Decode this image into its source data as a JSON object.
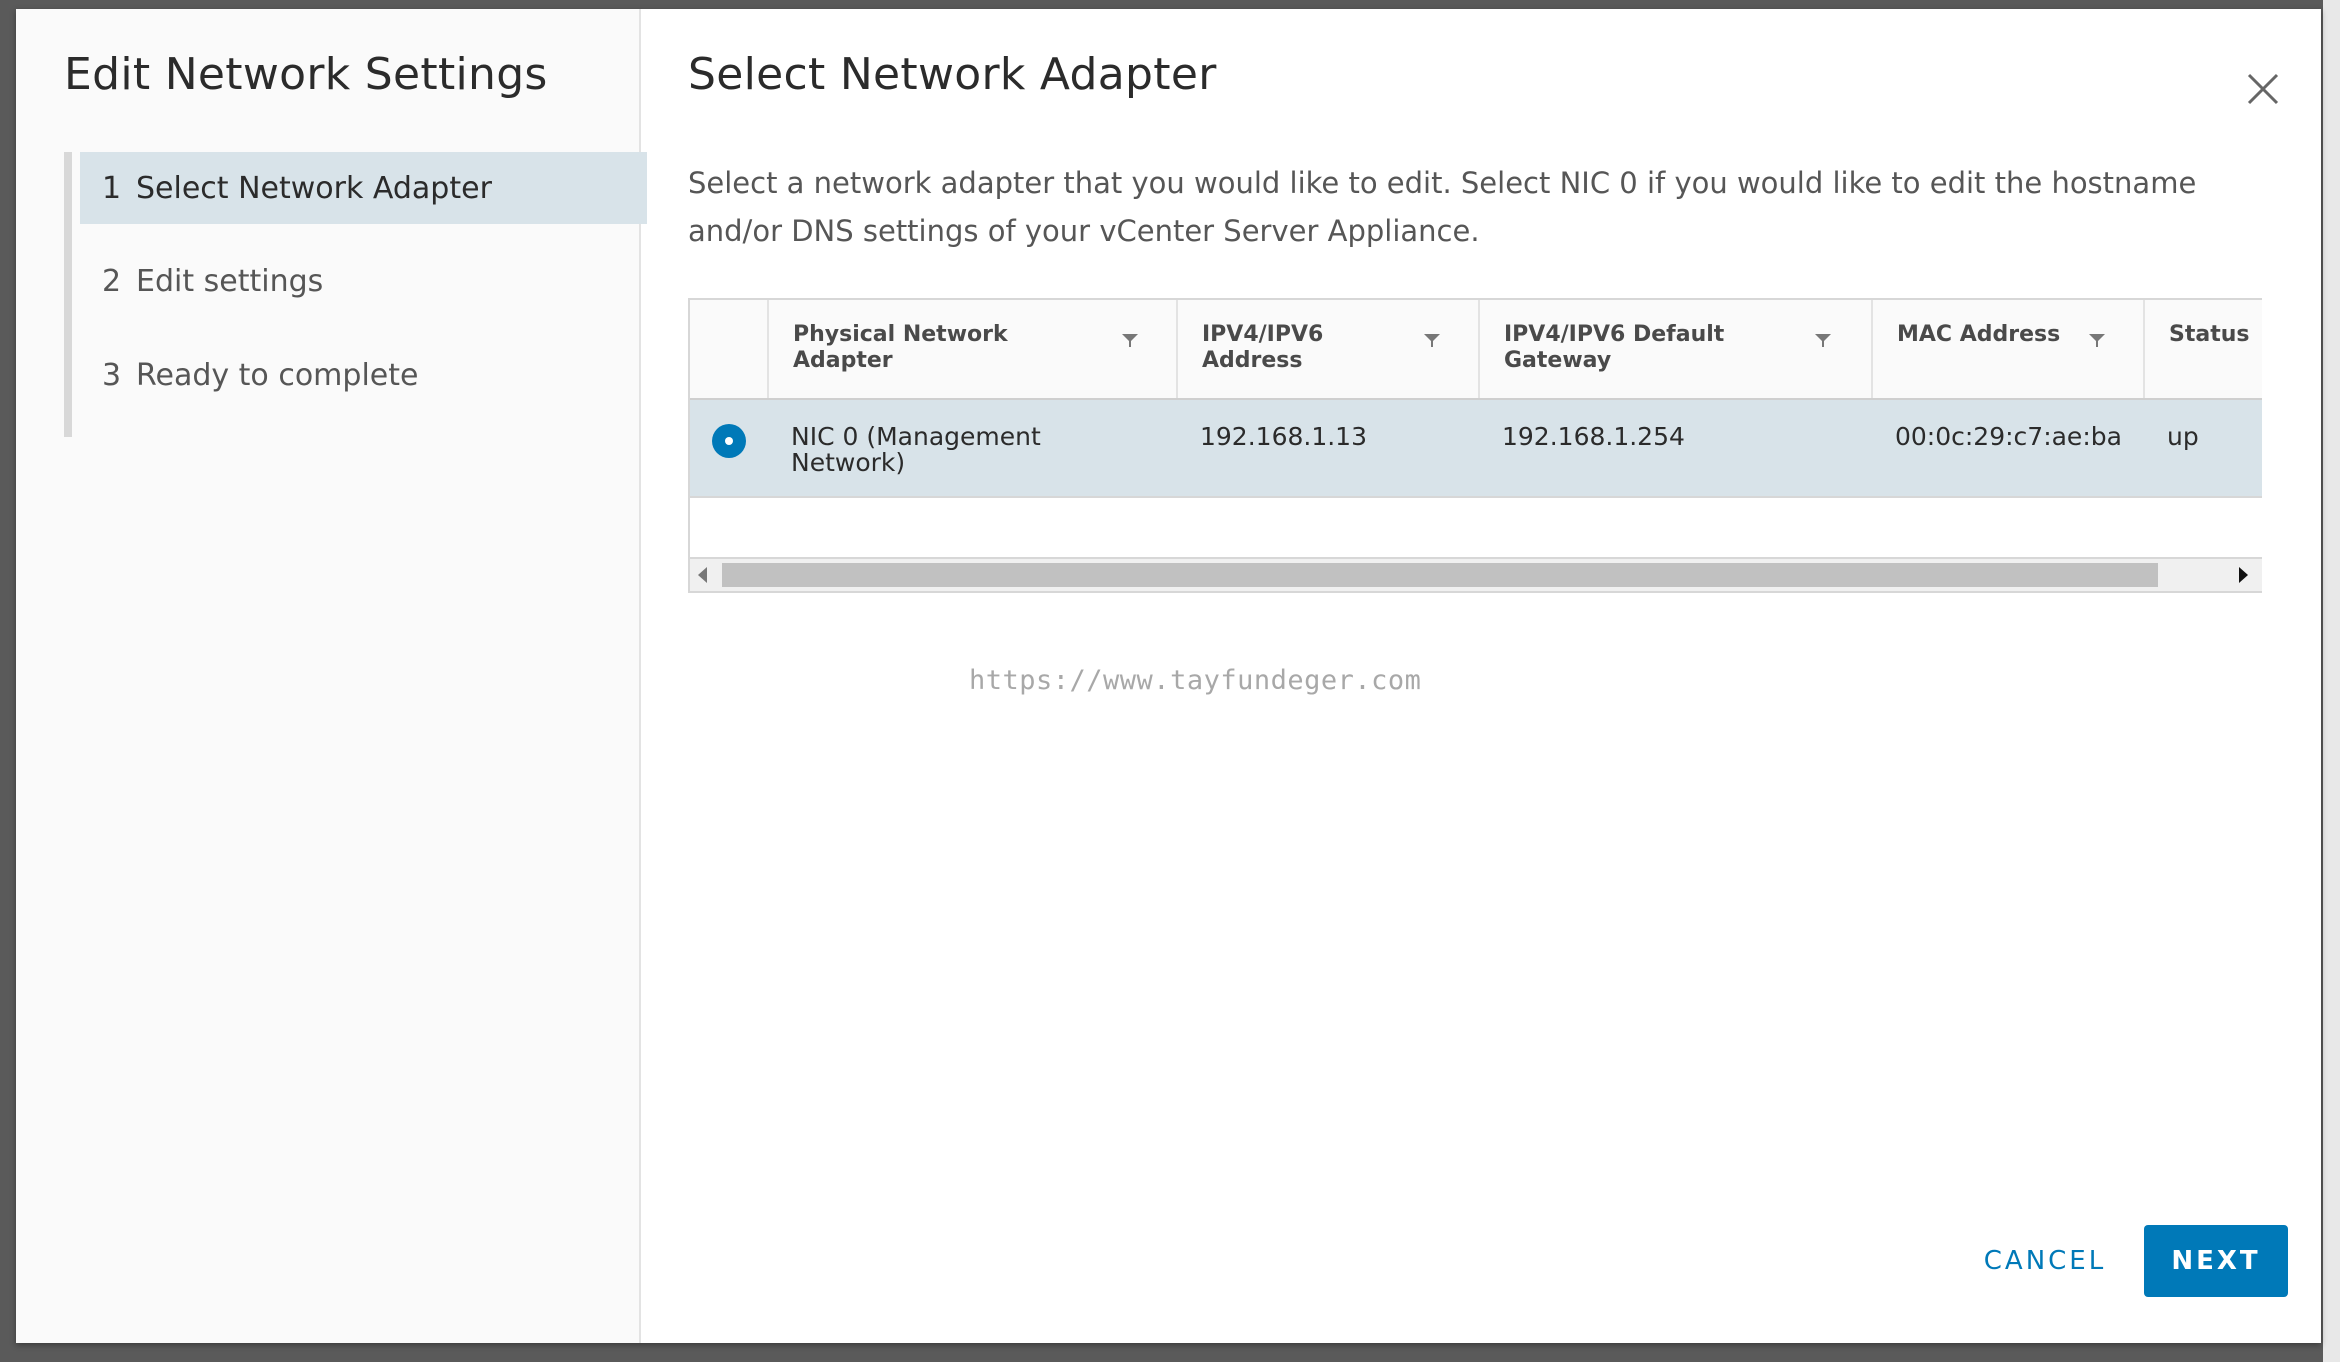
{
  "wizard": {
    "title": "Edit Network Settings",
    "steps": [
      {
        "number": "1",
        "label": "Select Network Adapter",
        "active": true
      },
      {
        "number": "2",
        "label": "Edit settings",
        "active": false
      },
      {
        "number": "3",
        "label": "Ready to complete",
        "active": false
      }
    ]
  },
  "page": {
    "title": "Select Network Adapter",
    "description": "Select a network adapter that you would like to edit. Select NIC 0 if you would like to edit the hostname and/or DNS settings of your vCenter Server Appliance.",
    "close_icon": "close-icon"
  },
  "grid": {
    "columns": [
      {
        "label": "Physical Network Adapter",
        "filter_icon": "filter-icon"
      },
      {
        "label": "IPV4/IPV6 Address",
        "filter_icon": "filter-icon"
      },
      {
        "label": "IPV4/IPV6 Default Gateway",
        "filter_icon": "filter-icon"
      },
      {
        "label": "MAC Address",
        "filter_icon": "filter-icon"
      },
      {
        "label": "Status"
      }
    ],
    "rows": [
      {
        "selected": true,
        "adapter": "NIC 0 (Management Network)",
        "address": "192.168.1.13",
        "gateway": "192.168.1.254",
        "mac": "00:0c:29:c7:ae:ba",
        "status": "up"
      }
    ]
  },
  "watermark": "https://www.tayfundeger.com",
  "footer": {
    "cancel_label": "CANCEL",
    "next_label": "NEXT"
  },
  "colors": {
    "accent": "#0079b8",
    "selected_row": "#d8e3e9"
  }
}
